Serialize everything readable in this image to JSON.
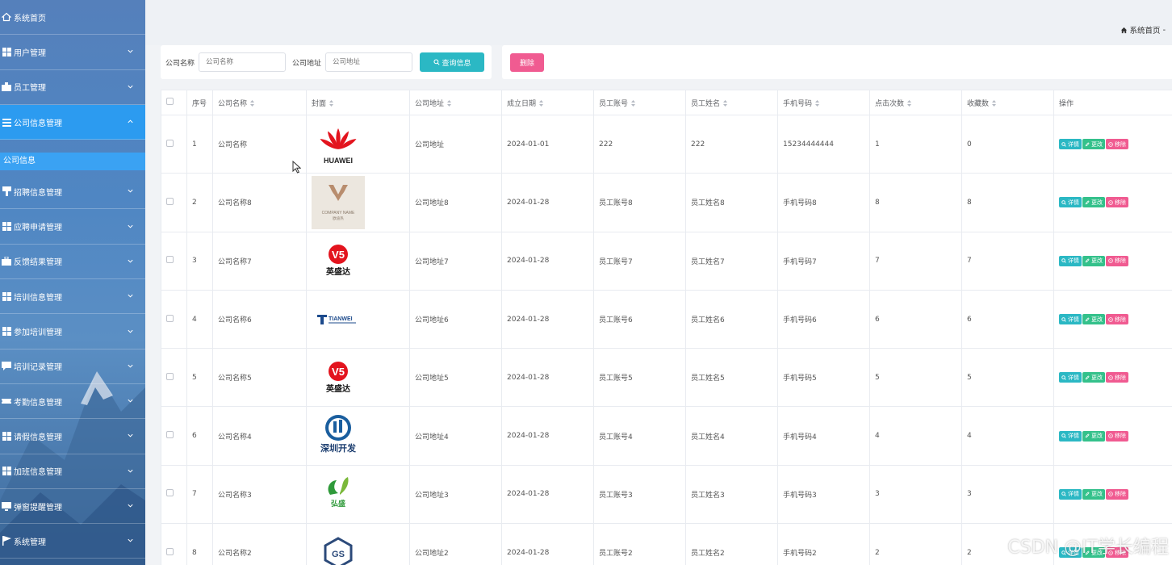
{
  "sidebar": {
    "items": [
      {
        "label": "系统首页",
        "icon": "home-icon",
        "expandable": false,
        "active": false
      },
      {
        "label": "用户管理",
        "icon": "grid-icon",
        "expandable": true,
        "active": false
      },
      {
        "label": "员工管理",
        "icon": "id-card-icon",
        "expandable": true,
        "active": false
      },
      {
        "label": "公司信息管理",
        "icon": "list-icon",
        "expandable": true,
        "active": true,
        "sub": [
          {
            "label": "公司信息"
          }
        ]
      },
      {
        "label": "招聘信息管理",
        "icon": "pin-icon",
        "expandable": true,
        "active": false
      },
      {
        "label": "应聘申请管理",
        "icon": "grid-icon",
        "expandable": true,
        "active": false
      },
      {
        "label": "反馈结果管理",
        "icon": "briefcase-icon",
        "expandable": true,
        "active": false
      },
      {
        "label": "培训信息管理",
        "icon": "grid-icon",
        "expandable": true,
        "active": false
      },
      {
        "label": "参加培训管理",
        "icon": "grid-icon",
        "expandable": true,
        "active": false
      },
      {
        "label": "培训记录管理",
        "icon": "chat-icon",
        "expandable": true,
        "active": false
      },
      {
        "label": "考勤信息管理",
        "icon": "ticket-icon",
        "expandable": true,
        "active": false
      },
      {
        "label": "请假信息管理",
        "icon": "grid-icon",
        "expandable": true,
        "active": false
      },
      {
        "label": "加班信息管理",
        "icon": "grid-icon",
        "expandable": true,
        "active": false
      },
      {
        "label": "弹窗提醒管理",
        "icon": "monitor-icon",
        "expandable": true,
        "active": false
      },
      {
        "label": "系统管理",
        "icon": "flag-icon",
        "expandable": true,
        "active": false
      }
    ]
  },
  "breadcrumb": {
    "home": "系统首页",
    "separator": "-"
  },
  "search": {
    "company_name_label": "公司名称",
    "company_name_placeholder": "公司名称",
    "company_addr_label": "公司地址",
    "company_addr_placeholder": "公司地址",
    "search_button": "查询信息"
  },
  "actions": {
    "delete_button": "删除"
  },
  "table": {
    "columns": [
      "序号",
      "公司名称",
      "封面",
      "公司地址",
      "成立日期",
      "员工账号",
      "员工姓名",
      "手机号码",
      "点击次数",
      "收藏数",
      "操作"
    ],
    "ops": {
      "detail": "详情",
      "edit": "更改",
      "remove": "移除"
    },
    "rows": [
      {
        "no": "1",
        "name": "公司名称",
        "logo": "huawei",
        "logo_text": "HUAWEI",
        "addr": "公司地址",
        "date": "2024-01-01",
        "account": "222",
        "staff": "222",
        "phone": "15234444444",
        "clicks": "1",
        "favs": "0"
      },
      {
        "no": "2",
        "name": "公司名称8",
        "logo": "company",
        "logo_text": "COMPANY NAME",
        "logo_sub": "欧迪热",
        "addr": "公司地址8",
        "date": "2024-01-28",
        "account": "员工账号8",
        "staff": "员工姓名8",
        "phone": "手机号码8",
        "clicks": "8",
        "favs": "8"
      },
      {
        "no": "3",
        "name": "公司名称7",
        "logo": "yingshengda",
        "logo_text": "英盛达",
        "addr": "公司地址7",
        "date": "2024-01-28",
        "account": "员工账号7",
        "staff": "员工姓名7",
        "phone": "手机号码7",
        "clicks": "7",
        "favs": "7"
      },
      {
        "no": "4",
        "name": "公司名称6",
        "logo": "tianwei",
        "logo_text": "TIANWEI",
        "addr": "公司地址6",
        "date": "2024-01-28",
        "account": "员工账号6",
        "staff": "员工姓名6",
        "phone": "手机号码6",
        "clicks": "6",
        "favs": "6"
      },
      {
        "no": "5",
        "name": "公司名称5",
        "logo": "yingshengda",
        "logo_text": "英盛达",
        "addr": "公司地址5",
        "date": "2024-01-28",
        "account": "员工账号5",
        "staff": "员工姓名5",
        "phone": "手机号码5",
        "clicks": "5",
        "favs": "5"
      },
      {
        "no": "6",
        "name": "公司名称4",
        "logo": "shenzhen",
        "logo_text": "深圳开发",
        "addr": "公司地址4",
        "date": "2024-01-28",
        "account": "员工账号4",
        "staff": "员工姓名4",
        "phone": "手机号码4",
        "clicks": "4",
        "favs": "4"
      },
      {
        "no": "7",
        "name": "公司名称3",
        "logo": "hongsheng",
        "logo_text": "弘盛",
        "addr": "公司地址3",
        "date": "2024-01-28",
        "account": "员工账号3",
        "staff": "员工姓名3",
        "phone": "手机号码3",
        "clicks": "3",
        "favs": "3"
      },
      {
        "no": "8",
        "name": "公司名称2",
        "logo": "gs",
        "logo_text": "GS",
        "addr": "公司地址2",
        "date": "2024-01-28",
        "account": "员工账号2",
        "staff": "员工姓名2",
        "phone": "手机号码2",
        "clicks": "2",
        "favs": "2"
      }
    ]
  },
  "watermark": "CSDN @IT学长编程",
  "colors": {
    "sidebar": "#4f86c3",
    "active": "#2c9bf0",
    "primary": "#2bb8c4",
    "success": "#34c18b",
    "danger": "#f05b91"
  }
}
